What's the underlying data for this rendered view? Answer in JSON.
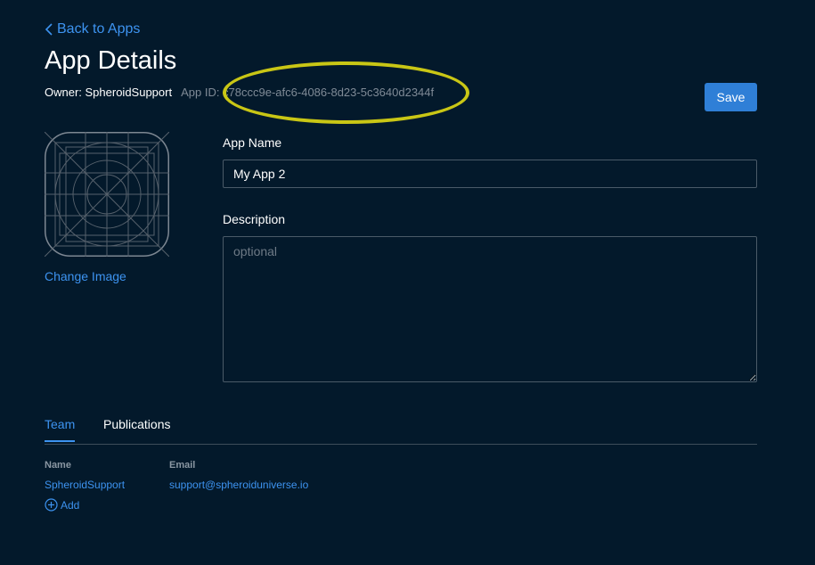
{
  "nav": {
    "back_label": "Back to Apps"
  },
  "page": {
    "title": "App Details",
    "owner_label": "Owner: SpheroidSupport",
    "app_id_label": "App ID: c78ccc9e-afc6-4086-8d23-5c3640d2344f"
  },
  "toolbar": {
    "save_label": "Save"
  },
  "image": {
    "change_label": "Change Image",
    "icon": "app-placeholder-icon"
  },
  "form": {
    "app_name_label": "App Name",
    "app_name_value": "My App 2",
    "description_label": "Description",
    "description_placeholder": "optional",
    "description_value": ""
  },
  "tabs": [
    {
      "label": "Team",
      "active": true
    },
    {
      "label": "Publications",
      "active": false
    }
  ],
  "team": {
    "columns": [
      "Name",
      "Email"
    ],
    "rows": [
      {
        "name": "SpheroidSupport",
        "email": "support@spheroiduniverse.io"
      }
    ],
    "add_label": "Add"
  },
  "colors": {
    "background": "#03192b",
    "accent": "#3d93f0",
    "save_button": "#2f7fd7",
    "highlight": "#c9c615"
  }
}
